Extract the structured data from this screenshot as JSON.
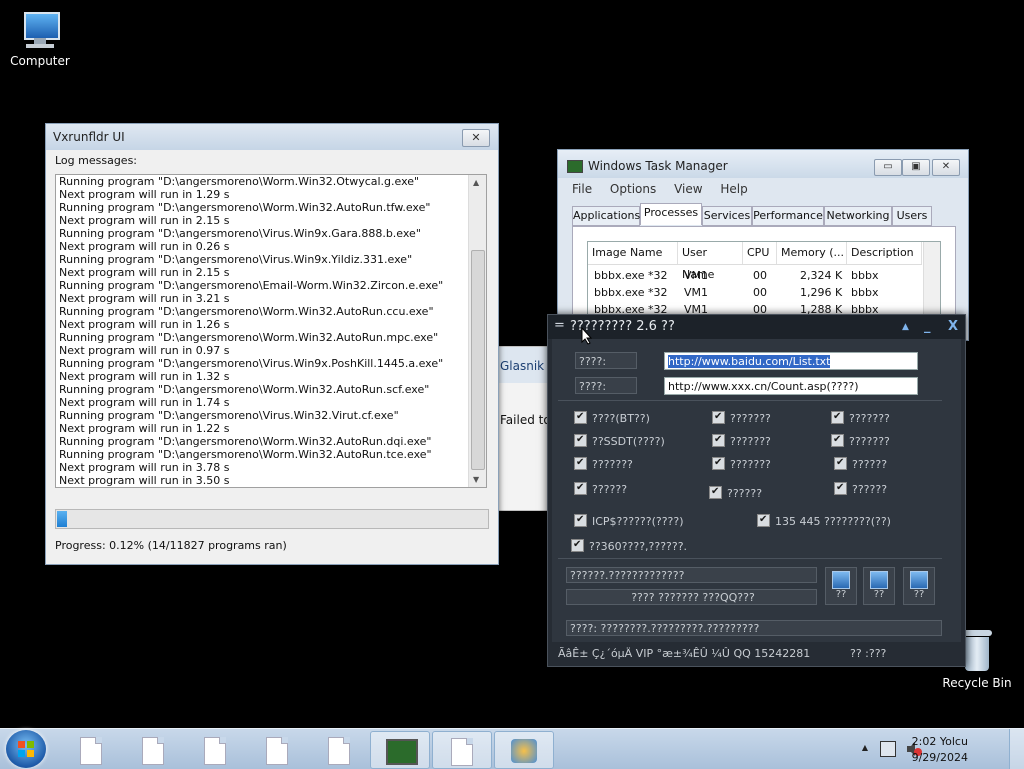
{
  "desktop": {
    "icons": [
      {
        "label": "Computer"
      },
      {
        "label": "Recycle Bin"
      }
    ]
  },
  "vxrunfldr": {
    "title": "Vxrunfldr UI",
    "close": "✕",
    "log_label": "Log messages:",
    "log": [
      "Running program \"D:\\angersmoreno\\Worm.Win32.Otwycal.g.exe\"",
      "Next program will run in 1.29 s",
      "Running program \"D:\\angersmoreno\\Worm.Win32.AutoRun.tfw.exe\"",
      "Next program will run in 2.15 s",
      "Running program \"D:\\angersmoreno\\Virus.Win9x.Gara.888.b.exe\"",
      "Next program will run in 0.26 s",
      "Running program \"D:\\angersmoreno\\Virus.Win9x.Yildiz.331.exe\"",
      "Next program will run in 2.15 s",
      "Running program \"D:\\angersmoreno\\Email-Worm.Win32.Zircon.e.exe\"",
      "Next program will run in 3.21 s",
      "Running program \"D:\\angersmoreno\\Worm.Win32.AutoRun.ccu.exe\"",
      "Next program will run in 1.26 s",
      "Running program \"D:\\angersmoreno\\Worm.Win32.AutoRun.mpc.exe\"",
      "Next program will run in 0.97 s",
      "Running program \"D:\\angersmoreno\\Virus.Win9x.PoshKill.1445.a.exe\"",
      "Next program will run in 1.32 s",
      "Running program \"D:\\angersmoreno\\Worm.Win32.AutoRun.scf.exe\"",
      "Next program will run in 1.74 s",
      "Running program \"D:\\angersmoreno\\Virus.Win32.Virut.cf.exe\"",
      "Next program will run in 1.22 s",
      "Running program \"D:\\angersmoreno\\Worm.Win32.AutoRun.dqi.exe\"",
      "Running program \"D:\\angersmoreno\\Worm.Win32.AutoRun.tce.exe\"",
      "Next program will run in 3.78 s",
      "Next program will run in 3.50 s"
    ],
    "progress_fraction": 0.0012,
    "progress_text": "Progress: 0.12% (14/11827 programs ran)"
  },
  "partial_window": {
    "heading": "Glasnik",
    "body": "Failed to"
  },
  "task_manager": {
    "title": "Windows Task Manager",
    "menu": [
      "File",
      "Options",
      "View",
      "Help"
    ],
    "tabs": [
      "Applications",
      "Processes",
      "Services",
      "Performance",
      "Networking",
      "Users"
    ],
    "selected_tab": "Processes",
    "columns": [
      "Image Name",
      "User Name",
      "CPU",
      "Memory (...",
      "Description"
    ],
    "rows": [
      [
        "bbbx.exe *32",
        "VM1",
        "00",
        "2,324 K",
        "bbbx"
      ],
      [
        "bbbx.exe *32",
        "VM1",
        "00",
        "1,296 K",
        "bbbx"
      ],
      [
        "bbbx.exe *32",
        "VM1",
        "00",
        "1,288 K",
        "bbbx"
      ]
    ],
    "buttons": {
      "minimize": "▭",
      "maximize": "▣",
      "close": "✕"
    }
  },
  "dark_app": {
    "menu_glyph": "=",
    "title": "????????? 2.6 ??",
    "title_buttons": {
      "up": "▲",
      "min": "_",
      "close": "X"
    },
    "field1_label": "????:",
    "field1_value": "http://www.baidu.com/List.txt",
    "field2_label": "????:",
    "field2_value": "http://www.xxx.cn/Count.asp(????)",
    "checks": [
      "????(BT??)",
      "???????",
      "???????",
      "??SSDT(????)",
      "???????",
      "???????",
      "???????",
      "???????",
      "??????",
      "??????",
      "??????",
      "??????",
      "ICP$??????(????)",
      "135 445 ????????(??)",
      "??360????,??????."
    ],
    "field3": "??????.?????????????",
    "field4": "???? ??????? ???QQ???",
    "field5": "????: ????????.?????????.?????????",
    "buttons": [
      "??",
      "??",
      "??"
    ],
    "status_left": "ÃâÊ± Ç¿´óµÄ VIP °æ±¾ÊÛ ¼Û QQ 15242281",
    "status_right": "?? :???"
  },
  "taskbar": {
    "clock_time": "2:02 Yolcu",
    "clock_date": "9/29/2024",
    "tray_arrow": "▲"
  }
}
